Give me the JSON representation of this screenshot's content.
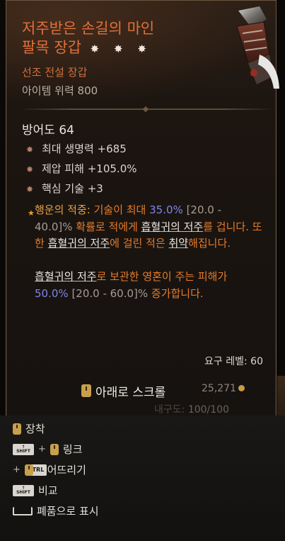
{
  "item": {
    "name_line1": "저주받은 손길의 마인",
    "name_line2": "팔목 장갑",
    "stars": "✸ ✸ ✸",
    "type": "선조 전설 장갑",
    "power": "아이템 위력 800"
  },
  "armor": "방어도 64",
  "affixes": [
    {
      "bullet": "✸",
      "text": "최대 생명력 +685"
    },
    {
      "bullet": "✸",
      "text": "제압 피해 +105.0%"
    },
    {
      "bullet": "✸",
      "text": "핵심 기술 +3"
    }
  ],
  "aspect": {
    "bullet": "★",
    "name": "행운의 적중: ",
    "p1": "기술이 최대 ",
    "v1": "35.0%",
    "r1": "[20.0 - 40.0]%",
    "p2": " 확률로 적에게 ",
    "t1": "흡혈귀의 저주",
    "p3": "를 겁니다. 또한 ",
    "t2": "흡혈귀의 저주",
    "p4": "에 걸린 적은 ",
    "t3": "취약",
    "p5": "해집니다.",
    "t4": "흡혈귀의 저주",
    "p6": "로 보관한 영혼이 주는 피해가 ",
    "v2": "50.0%",
    "r2": "[20.0 - 60.0]%",
    "p7": " 증가합니다."
  },
  "requirement": "요구 레벨: 60",
  "scroll_hint": "아래로 스크롤",
  "gold": "25,271",
  "durability": {
    "label": "내구도:",
    "value": "100/100"
  },
  "controls": [
    {
      "keys": "mouse",
      "label": "장착"
    },
    {
      "keys": "shift+mouse",
      "label": "링크"
    },
    {
      "keys": "ctrl+mouse",
      "label": "떨어뜨리기"
    },
    {
      "keys": "shift",
      "label": "비교"
    },
    {
      "keys": "space",
      "label": "폐품으로 표시"
    }
  ],
  "key_labels": {
    "shift": "SHIFT",
    "ctrl": "CTRL"
  },
  "colors": {
    "legendary": "#e0703b",
    "highlight": "#e57c2c",
    "value": "#7e86e6",
    "range": "#a59c92"
  }
}
